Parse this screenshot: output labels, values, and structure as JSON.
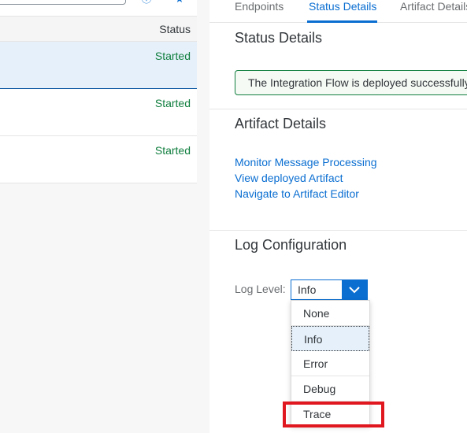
{
  "list": {
    "status_header": "Status",
    "rows": [
      {
        "status": "Started"
      },
      {
        "status": "Started"
      },
      {
        "status": "Started"
      }
    ]
  },
  "tabs": [
    "Endpoints",
    "Status Details",
    "Artifact Details"
  ],
  "active_tab": "Status Details",
  "status_details": {
    "title": "Status Details",
    "message": "The Integration Flow is deployed successfully."
  },
  "artifact_details": {
    "title": "Artifact Details",
    "links": [
      "Monitor Message Processing",
      "View deployed Artifact",
      "Navigate to Artifact Editor"
    ]
  },
  "log_configuration": {
    "title": "Log Configuration",
    "log_level_label": "Log Level:",
    "selected_value": "Info",
    "options": [
      "None",
      "Info",
      "Error",
      "Debug",
      "Trace"
    ],
    "highlighted_option": "Trace"
  },
  "colors": {
    "accent": "#0a6ed1",
    "success": "#107e3e",
    "highlight": "#e0171e"
  }
}
